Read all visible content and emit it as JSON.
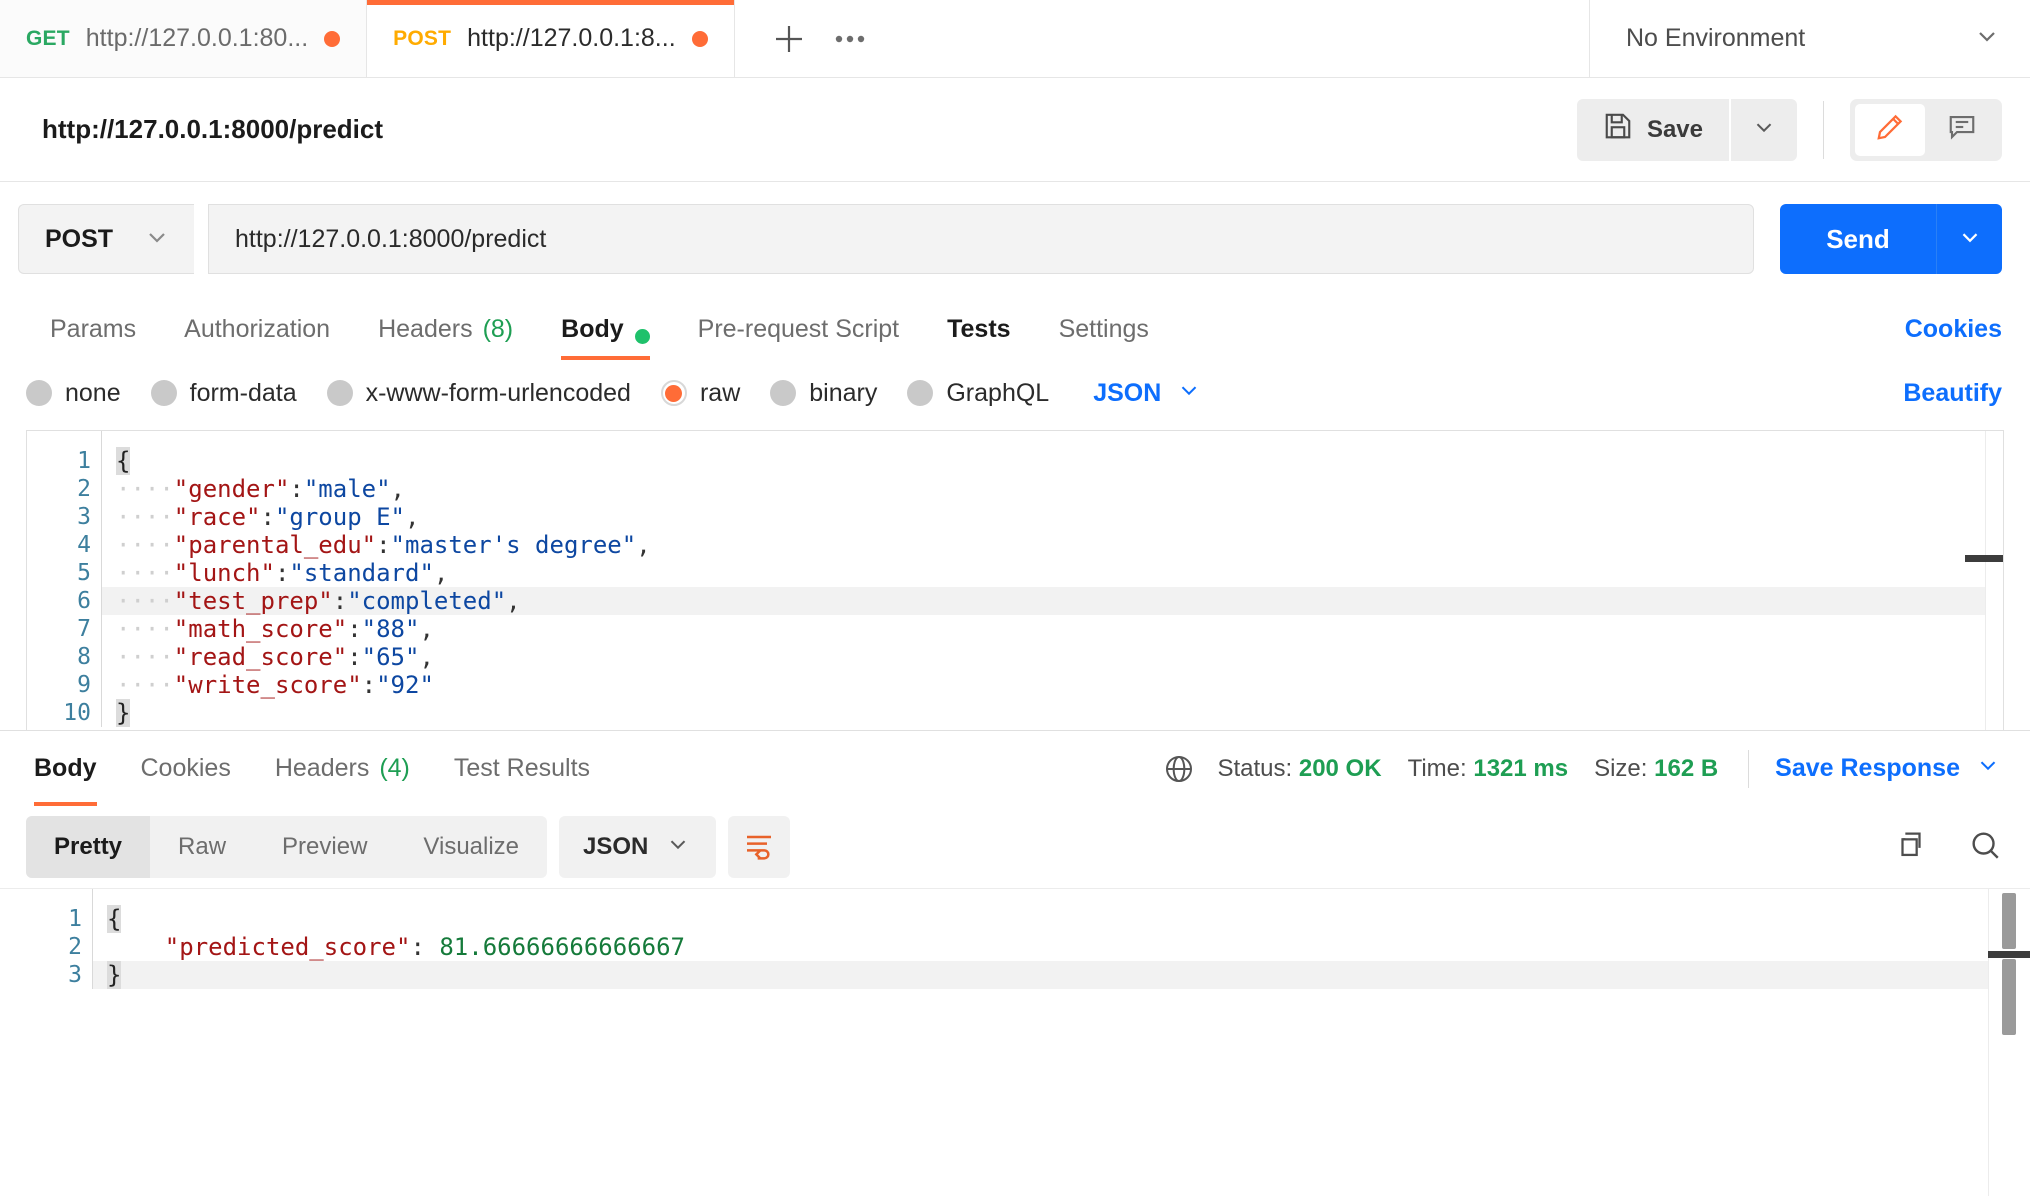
{
  "tabs": [
    {
      "method": "GET",
      "url": "http://127.0.0.1:80...",
      "unsaved": true,
      "active": false
    },
    {
      "method": "POST",
      "url": "http://127.0.0.1:8...",
      "unsaved": true,
      "active": true
    }
  ],
  "tabbar": {
    "new_tab_label": "+",
    "more_label": "●●●",
    "environment": "No Environment"
  },
  "request_header": {
    "title": "http://127.0.0.1:8000/predict",
    "save_label": "Save"
  },
  "url_bar": {
    "method": "POST",
    "url": "http://127.0.0.1:8000/predict",
    "send_label": "Send"
  },
  "request_tabs": [
    {
      "label": "Params",
      "active": false
    },
    {
      "label": "Authorization",
      "active": false
    },
    {
      "label": "Headers",
      "count": "(8)",
      "active": false
    },
    {
      "label": "Body",
      "active": true,
      "indicator": true
    },
    {
      "label": "Pre-request Script",
      "active": false
    },
    {
      "label": "Tests",
      "active": false,
      "bold": true
    },
    {
      "label": "Settings",
      "active": false
    }
  ],
  "cookies_link": "Cookies",
  "body_types": [
    {
      "label": "none",
      "selected": false
    },
    {
      "label": "form-data",
      "selected": false
    },
    {
      "label": "x-www-form-urlencoded",
      "selected": false
    },
    {
      "label": "raw",
      "selected": true
    },
    {
      "label": "binary",
      "selected": false
    },
    {
      "label": "GraphQL",
      "selected": false
    }
  ],
  "body_format": "JSON",
  "beautify_label": "Beautify",
  "request_body": {
    "line_numbers": [
      "1",
      "2",
      "3",
      "4",
      "5",
      "6",
      "7",
      "8",
      "9",
      "10"
    ],
    "lines": [
      {
        "indent": "",
        "key": "",
        "sep": "",
        "value": "",
        "comma": "",
        "open": "{",
        "close": ""
      },
      {
        "indent": "····",
        "key": "\"gender\"",
        "sep": ":",
        "value": "\"male\"",
        "comma": ","
      },
      {
        "indent": "····",
        "key": "\"race\"",
        "sep": ":",
        "value": "\"group E\"",
        "comma": ","
      },
      {
        "indent": "····",
        "key": "\"parental_edu\"",
        "sep": ":",
        "value": "\"master's degree\"",
        "comma": ","
      },
      {
        "indent": "····",
        "key": "\"lunch\"",
        "sep": ":",
        "value": "\"standard\"",
        "comma": ","
      },
      {
        "indent": "····",
        "key": "\"test_prep\"",
        "sep": ":",
        "value": "\"completed\"",
        "comma": ",",
        "highlight": true
      },
      {
        "indent": "····",
        "key": "\"math_score\"",
        "sep": ":",
        "value": "\"88\"",
        "comma": ","
      },
      {
        "indent": "····",
        "key": "\"read_score\"",
        "sep": ":",
        "value": "\"65\"",
        "comma": ","
      },
      {
        "indent": "····",
        "key": "\"write_score\"",
        "sep": ":",
        "value": "\"92\"",
        "comma": ""
      },
      {
        "indent": "",
        "key": "",
        "sep": "",
        "value": "",
        "comma": "",
        "close": "}"
      }
    ]
  },
  "response_tabs": [
    {
      "label": "Body",
      "active": true
    },
    {
      "label": "Cookies",
      "active": false
    },
    {
      "label": "Headers",
      "count": "(4)",
      "active": false
    },
    {
      "label": "Test Results",
      "active": false
    }
  ],
  "response_status": {
    "status_label": "Status:",
    "status_value": "200 OK",
    "time_label": "Time:",
    "time_value": "1321 ms",
    "size_label": "Size:",
    "size_value": "162 B",
    "save_response_label": "Save Response"
  },
  "response_view_modes": [
    {
      "label": "Pretty",
      "active": true
    },
    {
      "label": "Raw",
      "active": false
    },
    {
      "label": "Preview",
      "active": false
    },
    {
      "label": "Visualize",
      "active": false
    }
  ],
  "response_format": "JSON",
  "response_body": {
    "line_numbers": [
      "1",
      "2",
      "3"
    ],
    "lines": [
      {
        "open": "{"
      },
      {
        "indent": "    ",
        "key": "\"predicted_score\"",
        "sep": ": ",
        "number": "81.66666666666667"
      },
      {
        "close": "}",
        "highlight": true
      }
    ]
  },
  "colors": {
    "accent_orange": "#ff6c37",
    "accent_blue": "#0d6efd",
    "status_green": "#1e9e53",
    "json_key": "#a31515",
    "json_string": "#0d47a1",
    "json_number": "#157a3a"
  }
}
